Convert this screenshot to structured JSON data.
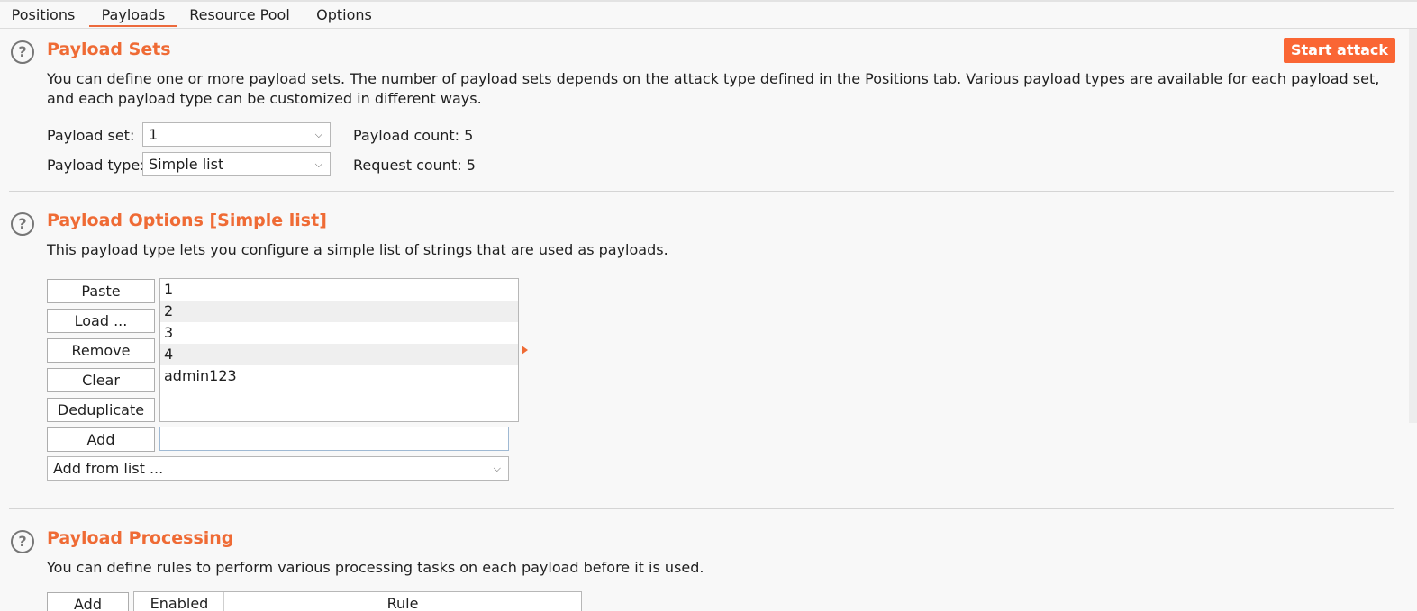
{
  "tabs": [
    {
      "label": "Positions",
      "active": false
    },
    {
      "label": "Payloads",
      "active": true
    },
    {
      "label": "Resource Pool",
      "active": false
    },
    {
      "label": "Options",
      "active": false
    }
  ],
  "accent_color": "#ef6b35",
  "payload_sets": {
    "title": "Payload Sets",
    "description": "You can define one or more payload sets. The number of payload sets depends on the attack type defined in the Positions tab. Various payload types are available for each payload set, and each payload type can be customized in different ways.",
    "start_attack_label": "Start attack",
    "payload_set_label": "Payload set:",
    "payload_set_value": "1",
    "payload_type_label": "Payload type:",
    "payload_type_value": "Simple list",
    "payload_count": "Payload count: 5",
    "request_count": "Request count: 5"
  },
  "payload_options": {
    "title": "Payload Options [Simple list]",
    "description": "This payload type lets you configure a simple list of strings that are used as payloads.",
    "buttons": {
      "paste": "Paste",
      "load": "Load ...",
      "remove": "Remove",
      "clear": "Clear",
      "deduplicate": "Deduplicate",
      "add": "Add"
    },
    "list_items": [
      "1",
      "2",
      "3",
      "4",
      "admin123"
    ],
    "add_input_value": "",
    "add_from_list": "Add from list ..."
  },
  "payload_processing": {
    "title": "Payload Processing",
    "description": "You can define rules to perform various processing tasks on each payload before it is used.",
    "add_label": "Add",
    "columns": [
      "Enabled",
      "Rule"
    ]
  },
  "icons": {
    "help": "?",
    "chevron": "⌵"
  }
}
